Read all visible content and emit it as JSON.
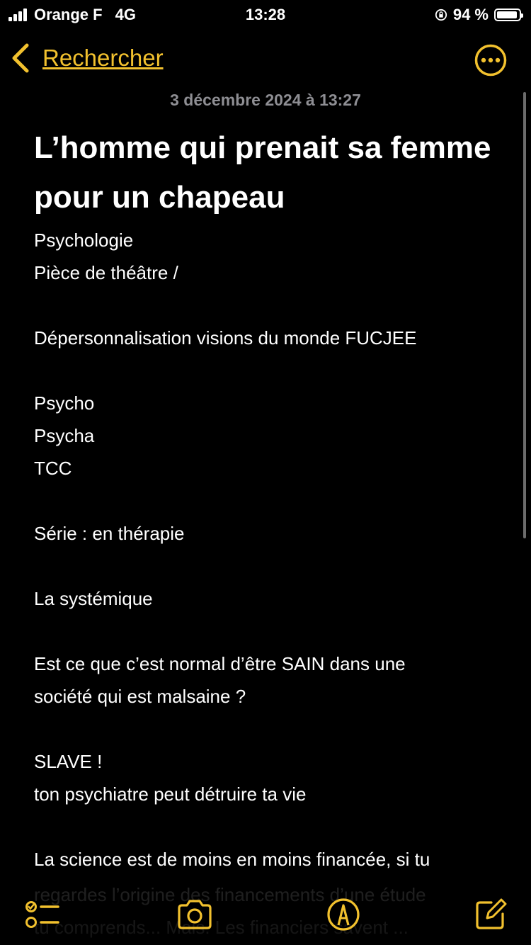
{
  "status_bar": {
    "carrier": "Orange F",
    "network": "4G",
    "time": "13:28",
    "battery_percent": "94 %",
    "battery_level": 0.94,
    "signal_bars": 4
  },
  "nav": {
    "back_label": "Rechercher",
    "more_icon": "ellipsis-circle-icon"
  },
  "note": {
    "date": "3 décembre 2024 à 13:27",
    "title": "L’homme qui prenait sa femme pour un chapeau",
    "lines": [
      "Psychologie",
      "Pièce de théâtre /",
      "",
      "Dépersonnalisation visions du monde FUCJEE",
      "",
      "Psycho",
      "Psycha",
      "TCC",
      "",
      "Série : en thérapie",
      "",
      "La systémique",
      "",
      "Est ce que c’est normal d’être SAIN dans une",
      "société qui est malsaine ?",
      "",
      "SLAVE !",
      "ton psychiatre peut détruire ta vie",
      "",
      "La science est de moins en moins financée, si tu"
    ],
    "faded_lines": [
      "regardes l’origine des financements d’une étude",
      "tu comprends... Mais. Les financiers savent ..."
    ]
  },
  "toolbar": {
    "checklist_icon": "checklist-icon",
    "camera_icon": "camera-icon",
    "markup_icon": "markup-pen-icon",
    "compose_icon": "compose-icon"
  },
  "colors": {
    "accent": "#f2c12e",
    "background": "#000000",
    "text": "#ffffff",
    "secondary_text": "#8e8e93"
  }
}
